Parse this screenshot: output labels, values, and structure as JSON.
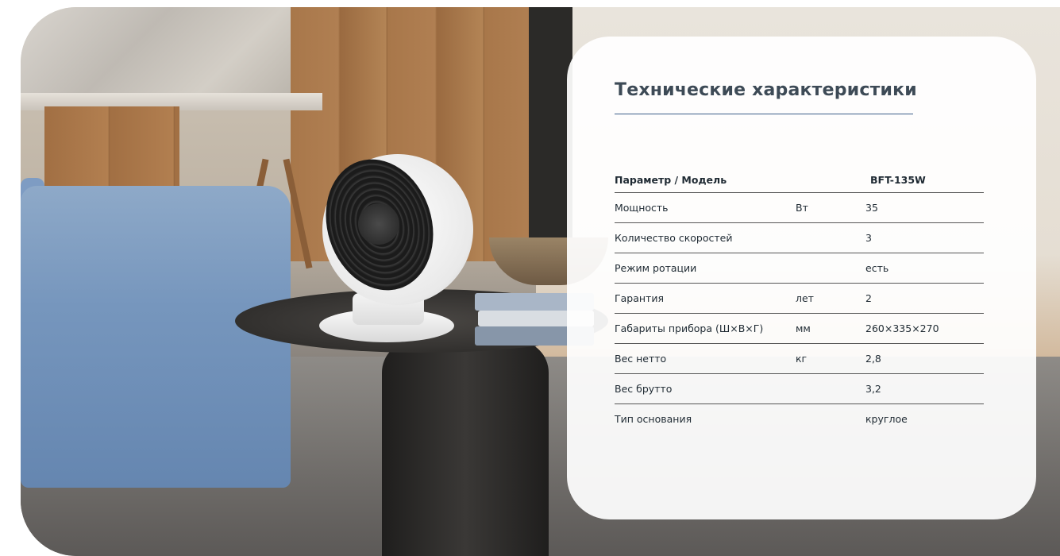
{
  "card": {
    "title": "Технические характеристики"
  },
  "specs": {
    "headers": [
      "Параметр / Модель",
      "",
      "BFT-135W"
    ],
    "rows": [
      {
        "param": "Мощность",
        "unit": "Вт",
        "value": "35"
      },
      {
        "param": "Количество скоростей",
        "unit": "",
        "value": "3"
      },
      {
        "param": "Режим ротации",
        "unit": "",
        "value": "есть"
      },
      {
        "param": "Гарантия",
        "unit": "лет",
        "value": "2"
      },
      {
        "param": "Габариты прибора (Ш×В×Г)",
        "unit": "мм",
        "value": "260×335×270"
      },
      {
        "param": "Вес нетто",
        "unit": "кг",
        "value": "2,8"
      },
      {
        "param": "Вес брутто",
        "unit": "",
        "value": "3,2"
      },
      {
        "param": "Тип основания",
        "unit": "",
        "value": "круглое"
      }
    ]
  },
  "colors": {
    "title_text": "#3d4a56",
    "title_rule": "#3b5f8a",
    "table_text": "#1f2a33"
  }
}
